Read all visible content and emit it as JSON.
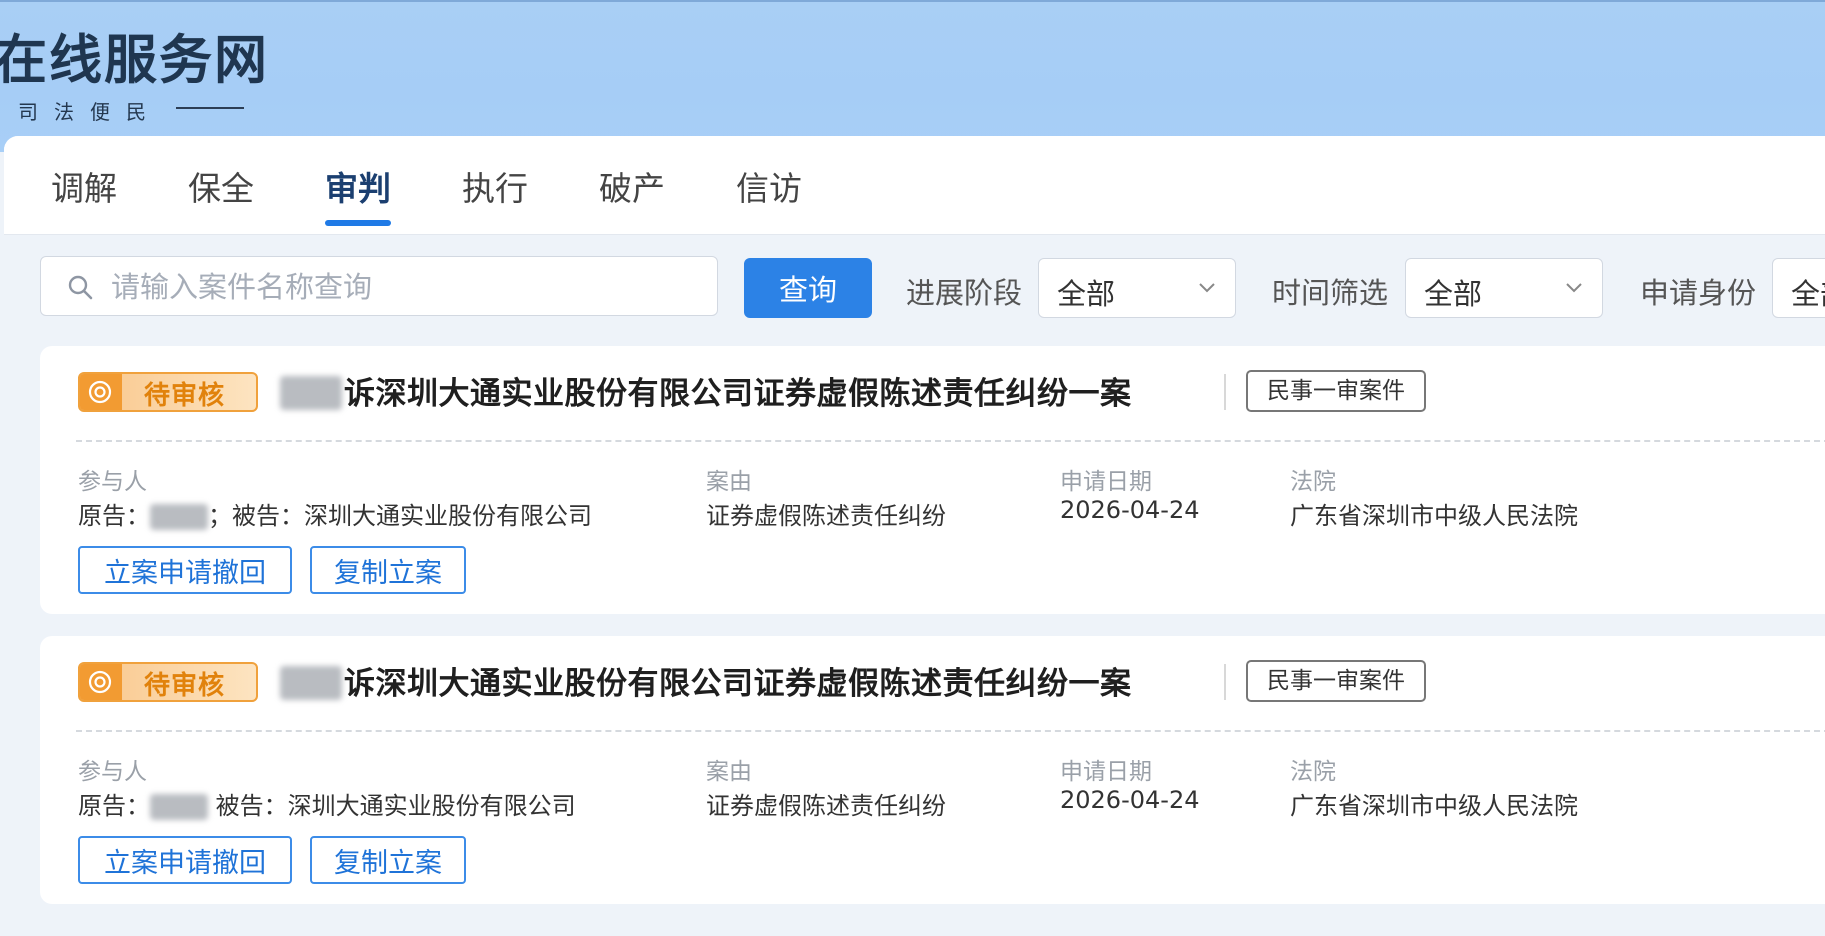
{
  "header": {
    "site_title": "在线服务网",
    "slogan": "司法便民"
  },
  "tabs": [
    {
      "label": "调解",
      "active": false
    },
    {
      "label": "保全",
      "active": false
    },
    {
      "label": "审判",
      "active": true
    },
    {
      "label": "执行",
      "active": false
    },
    {
      "label": "破产",
      "active": false
    },
    {
      "label": "信访",
      "active": false
    }
  ],
  "toolbar": {
    "search_placeholder": "请输入案件名称查询",
    "search_value": "",
    "query_label": "查询",
    "filters": [
      {
        "label": "进展阶段",
        "value": "全部"
      },
      {
        "label": "时间筛选",
        "value": "全部"
      },
      {
        "label": "申请身份",
        "value": "全部"
      }
    ]
  },
  "colors": {
    "accent": "#2c82e6",
    "pending": "#f29b32",
    "header_bg": "#a6cdf6"
  },
  "cases": [
    {
      "status": "待审核",
      "status_icon": "clock-icon",
      "title": "诉深圳大通实业股份有限公司证券虚假陈述责任纠纷一案",
      "type_tag": "民事一审案件",
      "fields": {
        "participants_label": "参与人",
        "plaintiff_label": "原告：",
        "defendant_text": "；被告：深圳大通实业股份有限公司",
        "cause_label": "案由",
        "cause_value": "证券虚假陈述责任纠纷",
        "date_label": "申请日期",
        "date_value": "2026-04-24",
        "court_label": "法院",
        "court_value": "广东省深圳市中级人民法院"
      },
      "actions": [
        "立案申请撤回",
        "复制立案"
      ]
    },
    {
      "status": "待审核",
      "status_icon": "clock-icon",
      "title": "诉深圳大通实业股份有限公司证券虚假陈述责任纠纷一案",
      "type_tag": "民事一审案件",
      "fields": {
        "participants_label": "参与人",
        "plaintiff_label": "原告：",
        "defendant_text": " 被告：深圳大通实业股份有限公司",
        "cause_label": "案由",
        "cause_value": "证券虚假陈述责任纠纷",
        "date_label": "申请日期",
        "date_value": "2026-04-24",
        "court_label": "法院",
        "court_value": "广东省深圳市中级人民法院"
      },
      "actions": [
        "立案申请撤回",
        "复制立案"
      ]
    }
  ]
}
